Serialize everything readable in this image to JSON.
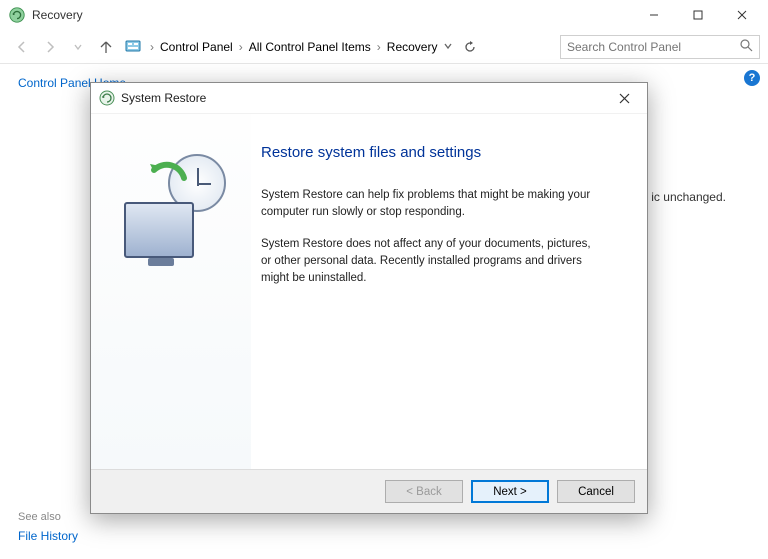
{
  "window": {
    "title": "Recovery"
  },
  "breadcrumbs": {
    "items": [
      "Control Panel",
      "All Control Panel Items",
      "Recovery"
    ]
  },
  "search": {
    "placeholder": "Search Control Panel"
  },
  "sidebar": {
    "home": "Control Panel Home",
    "see_also": "See also",
    "file_history": "File History"
  },
  "background": {
    "partial_text": "ic unchanged."
  },
  "dialog": {
    "title": "System Restore",
    "heading": "Restore system files and settings",
    "para1": "System Restore can help fix problems that might be making your computer run slowly or stop responding.",
    "para2": "System Restore does not affect any of your documents, pictures, or other personal data. Recently installed programs and drivers might be uninstalled.",
    "buttons": {
      "back": "< Back",
      "next": "Next >",
      "cancel": "Cancel"
    }
  }
}
